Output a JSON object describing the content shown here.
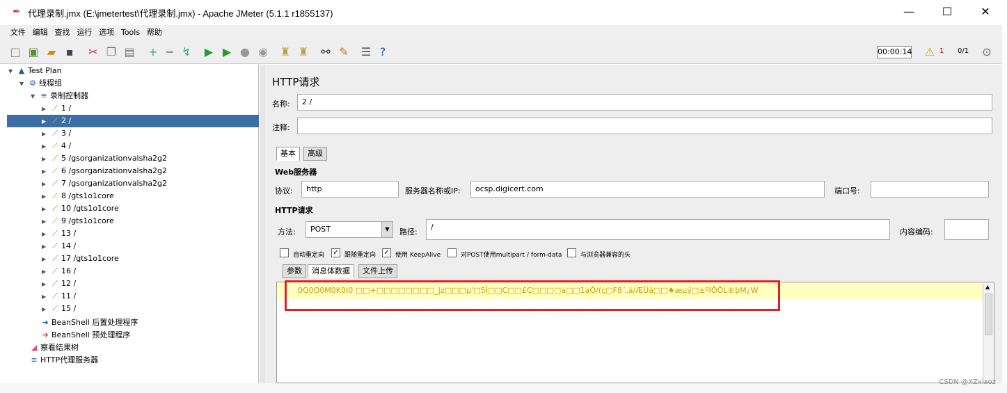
{
  "window": {
    "title": "代理录制.jmx (E:\\jmetertest\\代理录制.jmx) - Apache JMeter (5.1.1 r1855137)",
    "min": "—",
    "max": "☐",
    "close": "✕"
  },
  "menu": [
    "文件",
    "编辑",
    "查找",
    "运行",
    "选项",
    "Tools",
    "帮助"
  ],
  "toolbar": {
    "timer": "00:00:14",
    "warn_count": "1",
    "threads": "0/1"
  },
  "tree": [
    {
      "label": "Test Plan",
      "level": 0,
      "icon": "testplan-icon"
    },
    {
      "label": "线程组",
      "level": 1,
      "icon": "gear-icon"
    },
    {
      "label": "录制控制器",
      "level": 2,
      "icon": "controller-icon"
    },
    {
      "label": "1 /",
      "level": 3,
      "icon": "pipette-icon"
    },
    {
      "label": "2 /",
      "level": 3,
      "icon": "pipette-icon",
      "selected": true
    },
    {
      "label": "3 /",
      "level": 3,
      "icon": "pipette-icon"
    },
    {
      "label": "4 /",
      "level": 3,
      "icon": "pipette-icon"
    },
    {
      "label": "5 /gsorganizationvalsha2g2",
      "level": 3,
      "icon": "pipette-icon"
    },
    {
      "label": "6 /gsorganizationvalsha2g2",
      "level": 3,
      "icon": "pipette-icon"
    },
    {
      "label": "7 /gsorganizationvalsha2g2",
      "level": 3,
      "icon": "pipette-icon"
    },
    {
      "label": "8 /gts1o1core",
      "level": 3,
      "icon": "pipette-icon"
    },
    {
      "label": "10 /gts1o1core",
      "level": 3,
      "icon": "pipette-icon"
    },
    {
      "label": "9 /gts1o1core",
      "level": 3,
      "icon": "pipette-icon"
    },
    {
      "label": "13 /",
      "level": 3,
      "icon": "pipette-icon"
    },
    {
      "label": "14 /",
      "level": 3,
      "icon": "pipette-icon"
    },
    {
      "label": "17 /gts1o1core",
      "level": 3,
      "icon": "pipette-icon"
    },
    {
      "label": "16 /",
      "level": 3,
      "icon": "pipette-icon"
    },
    {
      "label": "12 /",
      "level": 3,
      "icon": "pipette-icon"
    },
    {
      "label": "11 /",
      "level": 3,
      "icon": "pipette-icon"
    },
    {
      "label": "15 /",
      "level": 3,
      "icon": "pipette-icon"
    },
    {
      "label": "BeanShell 后置处理程序",
      "level": 2,
      "icon": "postprocessor-icon",
      "leaf": true
    },
    {
      "label": "BeanShell 预处理程序",
      "level": 2,
      "icon": "preprocessor-icon",
      "leaf": true
    },
    {
      "label": "察看结果树",
      "level": 1,
      "icon": "results-tree-icon",
      "leaf": true
    },
    {
      "label": "HTTP代理服务器",
      "level": 1,
      "icon": "proxy-icon",
      "leaf": true
    }
  ],
  "panel": {
    "title": "HTTP请求",
    "name_label": "名称:",
    "name_value": "2 /",
    "comment_label": "注释:",
    "comment_value": "",
    "tabs": [
      "基本",
      "高级"
    ],
    "web_server_section": "Web服务器",
    "protocol_label": "协议:",
    "protocol_value": "http",
    "server_label": "服务器名称或IP:",
    "server_value": "ocsp.digicert.com",
    "port_label": "端口号:",
    "port_value": "",
    "http_request_section": "HTTP请求",
    "method_label": "方法:",
    "method_value": "POST",
    "path_label": "路径:",
    "path_value": "/",
    "encoding_label": "内容编码:",
    "encoding_value": "",
    "checkboxes": [
      {
        "label": "自动重定向",
        "checked": false
      },
      {
        "label": "跟随重定向",
        "checked": true
      },
      {
        "label": "使用 KeepAlive",
        "checked": true
      },
      {
        "label": "对POST使用multipart / form-data",
        "checked": false
      },
      {
        "label": "与浏览器兼容的头",
        "checked": false
      }
    ],
    "subtabs": [
      "参数",
      "消息体数据",
      "文件上传"
    ],
    "body_text": "0Q0O0M0K0I0     □□+□□□□□□□□_|z□□□µ'□5Î□□C□□£Ç□□□□a□□1aÕ/(ç□F8´,á/ÆÜá□□♠æµý□±ºÍÕÕL®þM¿W"
  },
  "watermark": "CSDN @XZxiaoz"
}
